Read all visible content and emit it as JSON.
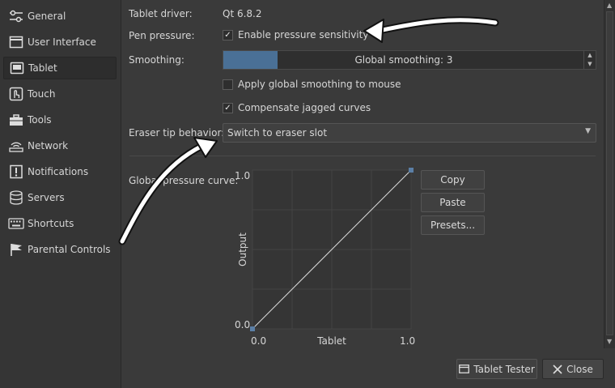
{
  "sidebar": {
    "items": [
      {
        "label": "General",
        "icon": "sliders-icon"
      },
      {
        "label": "User Interface",
        "icon": "window-icon"
      },
      {
        "label": "Tablet",
        "icon": "tablet-icon",
        "active": true
      },
      {
        "label": "Touch",
        "icon": "touch-icon"
      },
      {
        "label": "Tools",
        "icon": "toolbox-icon"
      },
      {
        "label": "Network",
        "icon": "network-icon"
      },
      {
        "label": "Notifications",
        "icon": "notification-icon"
      },
      {
        "label": "Servers",
        "icon": "server-icon"
      },
      {
        "label": "Shortcuts",
        "icon": "keyboard-icon"
      },
      {
        "label": "Parental Controls",
        "icon": "flag-icon"
      }
    ]
  },
  "tablet": {
    "driver_label": "Tablet driver:",
    "driver_value": "Qt 6.8.2",
    "pen_pressure_label": "Pen pressure:",
    "pressure_checkbox": {
      "label": "Enable pressure sensitivity",
      "checked": true
    },
    "smoothing_label": "Smoothing:",
    "smoothing_text": "Global smoothing: 3",
    "smoothing_level": 3,
    "smoothing_fraction": 0.15,
    "mouse_smoothing_checkbox": {
      "label": "Apply global smoothing to mouse",
      "checked": false
    },
    "jagged_checkbox": {
      "label": "Compensate jagged curves",
      "checked": true
    },
    "eraser_label": "Eraser tip behavior:",
    "eraser_value": "Switch to eraser slot",
    "curve_label": "Global pressure curve:",
    "curve": {
      "y_max_label": "1.0",
      "y_min_label": "0.0",
      "x_min_label": "0.0",
      "x_max_label": "1.0",
      "x_axis_label": "Tablet",
      "y_axis_label": "Output",
      "points": [
        [
          0,
          0
        ],
        [
          1,
          1
        ]
      ]
    },
    "buttons": {
      "copy": "Copy",
      "paste": "Paste",
      "presets": "Presets..."
    }
  },
  "footer": {
    "tablet_tester": "Tablet Tester",
    "close": "Close"
  },
  "colors": {
    "accent": "#4a7096",
    "background": "#3a3a3a",
    "sidebar": "#353535"
  }
}
